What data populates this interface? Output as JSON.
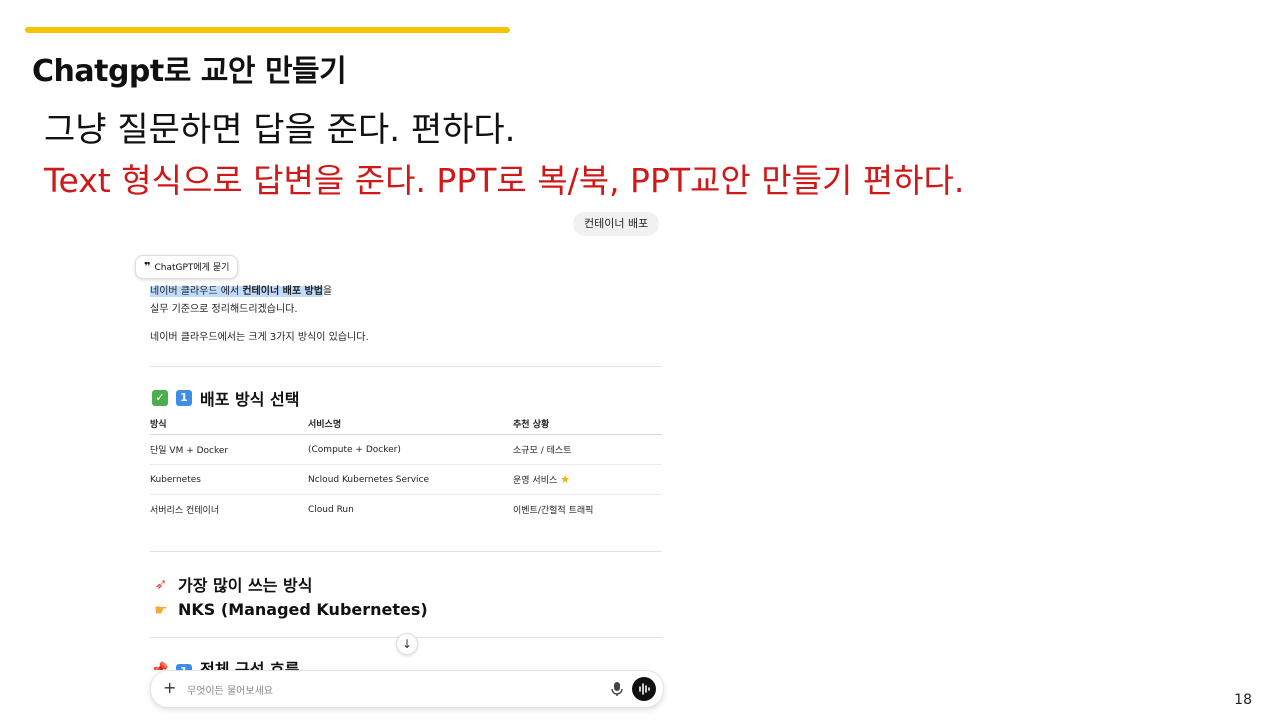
{
  "slide": {
    "title": "Chatgpt로 교안 만들기",
    "line1": "그냥 질문하면 답을 준다.  편하다.",
    "line2": "Text 형식으로 답변을 준다.  PPT로 복/북, PPT교안 만들기 편하다.",
    "page_number": "18",
    "accent_color": "#f5c400",
    "red_color": "#d01818"
  },
  "chat": {
    "user_message": "컨테이너 배포",
    "ask_chip": "ChatGPT에게 묻기",
    "answer": {
      "intro_a": "네이버 클라우드 에서 ",
      "intro_bold": "컨테이너 배포 방법",
      "intro_b": "을",
      "intro_line2": "실무 기준으로 정리해드리겠습니다.",
      "para2": "네이버 클라우드에서는 크게 3가지 방식이 있습니다."
    },
    "section1": {
      "icon1": "check-emoji",
      "icon2": "keycap-1-emoji",
      "title": "배포 방식 선택"
    },
    "table": {
      "headers": [
        "방식",
        "서비스명",
        "추천 상황"
      ],
      "rows": [
        [
          "단일 VM + Docker",
          "(Compute + Docker)",
          "소규모 / 테스트"
        ],
        [
          "Kubernetes",
          "Ncloud Kubernetes Service",
          "운영 서비스"
        ],
        [
          "서버리스 컨테이너",
          "Cloud Run",
          "이벤트/간헐적 트래픽"
        ]
      ],
      "star_icon": "star-emoji"
    },
    "section2": {
      "rocket_icon": "rocket-emoji",
      "line1": "가장 많이 쓰는 방식",
      "point_icon": "pointing-hand-emoji",
      "line2": "NKS (Managed Kubernetes)"
    },
    "section3": {
      "pin_icon": "pushpin-emoji",
      "title": "전체 구성 흐름"
    },
    "input": {
      "placeholder": "무엇이든 물어보세요"
    }
  }
}
